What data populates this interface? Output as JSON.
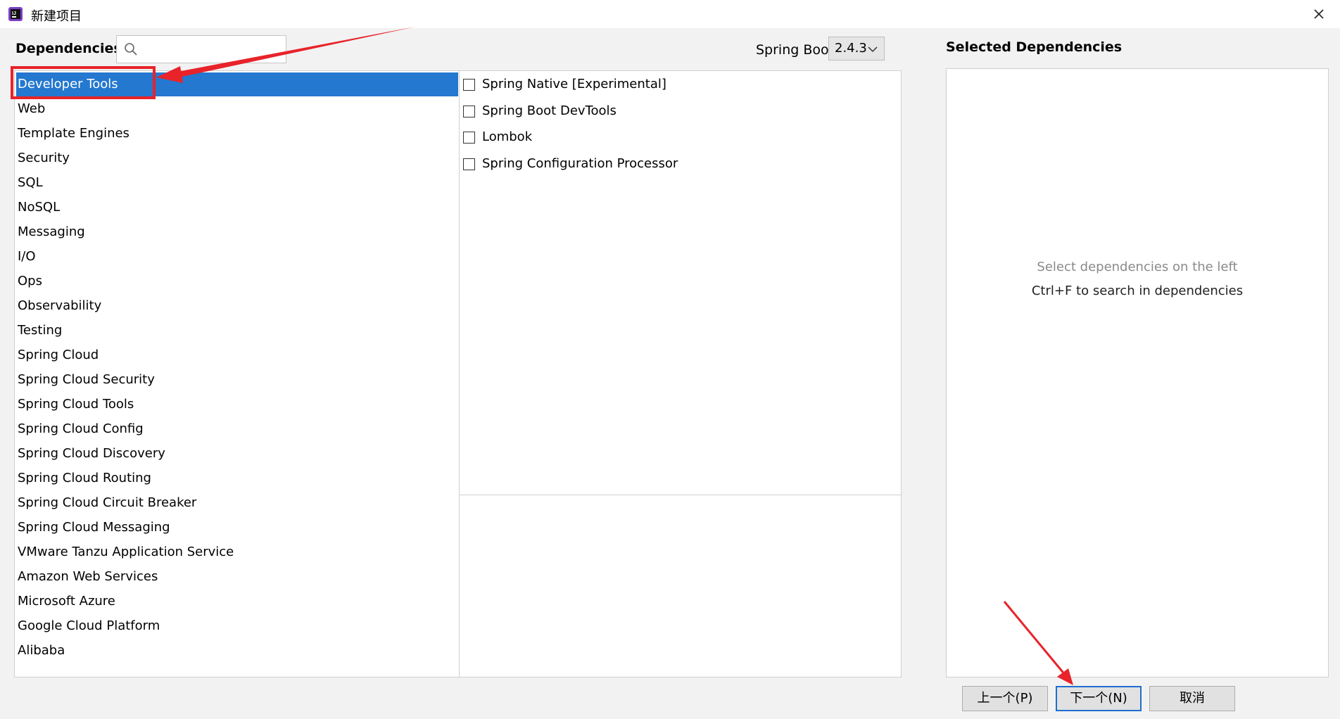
{
  "window": {
    "title": "新建项目"
  },
  "header": {
    "dependencies_label": "Dependencies",
    "search": {
      "value": "",
      "placeholder": ""
    },
    "spring_boot_label": "Spring Boot",
    "spring_boot_version": "2.4.3"
  },
  "categories": [
    {
      "label": "Developer Tools",
      "selected": true
    },
    {
      "label": "Web"
    },
    {
      "label": "Template Engines"
    },
    {
      "label": "Security"
    },
    {
      "label": "SQL"
    },
    {
      "label": "NoSQL"
    },
    {
      "label": "Messaging"
    },
    {
      "label": "I/O"
    },
    {
      "label": "Ops"
    },
    {
      "label": "Observability"
    },
    {
      "label": "Testing"
    },
    {
      "label": "Spring Cloud"
    },
    {
      "label": "Spring Cloud Security"
    },
    {
      "label": "Spring Cloud Tools"
    },
    {
      "label": "Spring Cloud Config"
    },
    {
      "label": "Spring Cloud Discovery"
    },
    {
      "label": "Spring Cloud Routing"
    },
    {
      "label": "Spring Cloud Circuit Breaker"
    },
    {
      "label": "Spring Cloud Messaging"
    },
    {
      "label": "VMware Tanzu Application Service"
    },
    {
      "label": "Amazon Web Services"
    },
    {
      "label": "Microsoft Azure"
    },
    {
      "label": "Google Cloud Platform"
    },
    {
      "label": "Alibaba"
    }
  ],
  "options": [
    {
      "label": "Spring Native [Experimental]",
      "checked": false
    },
    {
      "label": "Spring Boot DevTools",
      "checked": false
    },
    {
      "label": "Lombok",
      "checked": false
    },
    {
      "label": "Spring Configuration Processor",
      "checked": false
    }
  ],
  "selected_panel": {
    "title": "Selected Dependencies",
    "hint_primary": "Select dependencies on the left",
    "hint_secondary": "Ctrl+F to search in dependencies"
  },
  "footer": {
    "prev_label": "上一个(P)",
    "next_label": "下一个(N)",
    "cancel_label": "取消"
  },
  "colors": {
    "selection": "#2478cf",
    "annotation_red": "#e8232a",
    "primary_border": "#1e6fd0"
  }
}
